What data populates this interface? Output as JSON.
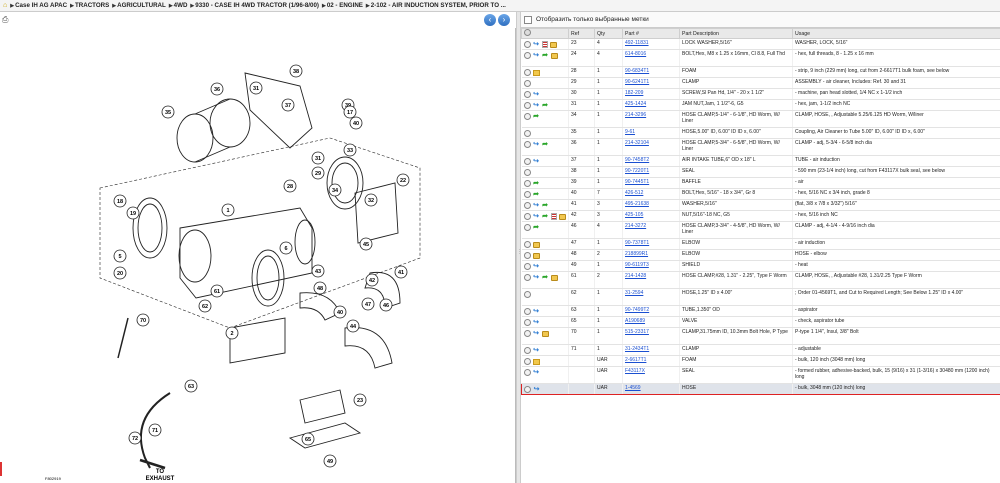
{
  "breadcrumb": [
    "Case IH AG APAC",
    "TRACTORS",
    "AGRICULTURAL",
    "4WD",
    "9330 - CASE IH 4WD TRACTOR (1/96-8/00)",
    "02 - ENGINE",
    "2-102 - AIR INDUCTION SYSTEM, PRIOR TO ..."
  ],
  "filter_label": "Отобразить только выбранные метки",
  "columns": {
    "ref": "Ref",
    "qty": "Qty",
    "part": "Part #",
    "desc": "Part Description",
    "usage": "Usage"
  },
  "diagram": {
    "callouts": [
      "38",
      "31",
      "36",
      "37",
      "39",
      "17",
      "40",
      "35",
      "33",
      "31",
      "29",
      "28",
      "32",
      "34",
      "22",
      "1",
      "6",
      "18",
      "19",
      "42",
      "43",
      "45",
      "48",
      "40",
      "44",
      "41",
      "46",
      "47",
      "5",
      "20",
      "61",
      "2",
      "70",
      "62",
      "63",
      "71",
      "72",
      "49",
      "65",
      "23"
    ],
    "exhaust_label": "TO\nEXHAUST",
    "figure_id": "F802919"
  },
  "rows": [
    {
      "icons": [
        "info",
        "arrow",
        "doc",
        "pkg"
      ],
      "ref": "23",
      "qty": "4",
      "part": "492-11831",
      "desc": "LOCK WASHER,5/16\"",
      "usage": "WASHER, LOCK, 5/16\"",
      "h": 1
    },
    {
      "icons": [
        "info",
        "arrow",
        "green",
        "pkg"
      ],
      "ref": "24",
      "qty": "4",
      "part": "614-8016",
      "desc": "BOLT,Hex, M8 x 1.25 x 16mm, Cl 8.8, Full Thd",
      "usage": "- hex, full threads, 8 - 1.25 x 16 mm",
      "h": 2
    },
    {
      "icons": [
        "info",
        "note"
      ],
      "ref": "28",
      "qty": "1",
      "part": "90-6834T1",
      "desc": "FOAM",
      "usage": "- strip, 9 inch (229 mm) long, cut from 2-6617T1 bulk foam, see below",
      "h": 1
    },
    {
      "icons": [
        "info"
      ],
      "ref": "29",
      "qty": "1",
      "part": "90-6241T1",
      "desc": "CLAMP",
      "usage": "ASSEMBLY - air cleaner, Includes: Ref. 30 and 31",
      "h": 1
    },
    {
      "icons": [
        "info",
        "arrow"
      ],
      "ref": "30",
      "qty": "1",
      "part": "182-209",
      "desc": "SCREW,Sl Pan Hd, 1/4\" - 20 x 1 1/2\"",
      "usage": "- machine, pan head slotted, 1/4 NC x 1-1/2 inch",
      "h": 1
    },
    {
      "icons": [
        "info",
        "arrow",
        "green"
      ],
      "ref": "31",
      "qty": "1",
      "part": "425-1424",
      "desc": "JAM NUT,Jam, 1 1/2\"-6, G5",
      "usage": "- hex, jam, 1-1/2 inch NC",
      "h": 1
    },
    {
      "icons": [
        "info",
        "green"
      ],
      "ref": "34",
      "qty": "1",
      "part": "214-3296",
      "desc": "HOSE CLAMP,5-1/4\" - 6-1/8\", HD Worm, W/ Liner",
      "usage": "CLAMP, HOSE, , Adjustable 5.25/6.125 HD Worm, W/liner",
      "h": 2
    },
    {
      "icons": [
        "info"
      ],
      "ref": "35",
      "qty": "1",
      "part": "9-61",
      "desc": "HOSE,5.00\" ID, 6.00\" ID ID x, 6.00\"",
      "usage": "Coupling, Air Cleaner to Tube 5.00\" ID, 6.00\" ID ID x, 6.00\"",
      "h": 1
    },
    {
      "icons": [
        "info",
        "arrow",
        "green"
      ],
      "ref": "36",
      "qty": "1",
      "part": "214-32104",
      "desc": "HOSE CLAMP,5-3/4\" - 6-5/8\", HD Worm, W/ Liner",
      "usage": "CLAMP - adj, 5-3/4 - 6-5/8 inch dia",
      "h": 2
    },
    {
      "icons": [
        "info",
        "arrow"
      ],
      "ref": "37",
      "qty": "1",
      "part": "90-7458T2",
      "desc": "AIR INTAKE TUBE,6\" OD x 18\" L",
      "usage": "TUBE - air induction",
      "h": 1
    },
    {
      "icons": [
        "info"
      ],
      "ref": "38",
      "qty": "1",
      "part": "90-7220T1",
      "desc": "SEAL",
      "usage": "- 590 mm (23-1/4 inch) long, cut from F43117X bulk seal, see below",
      "h": 1
    },
    {
      "icons": [
        "info",
        "green"
      ],
      "ref": "39",
      "qty": "1",
      "part": "90-7445T1",
      "desc": "BAFFLE",
      "usage": "- air",
      "h": 1
    },
    {
      "icons": [
        "info",
        "green"
      ],
      "ref": "40",
      "qty": "7",
      "part": "426-512",
      "desc": "BOLT,Hex, 5/16\" - 18 x 3/4\", Gr 8",
      "usage": "- hex, 5/16 NC x 3/4 inch, grade 8",
      "h": 1
    },
    {
      "icons": [
        "info",
        "arrow",
        "green"
      ],
      "ref": "41",
      "qty": "3",
      "part": "495-21638",
      "desc": "WASHER,5/16\"",
      "usage": "(flat, 3/8 x 7/8 x 3/32\") 5/16\"",
      "h": 1
    },
    {
      "icons": [
        "info",
        "arrow",
        "green",
        "doc",
        "pkg"
      ],
      "ref": "42",
      "qty": "3",
      "part": "425-105",
      "desc": "NUT,5/16\"-18 NC, G5",
      "usage": "- hex, 5/16 inch NC",
      "h": 1
    },
    {
      "icons": [
        "info",
        "green"
      ],
      "ref": "46",
      "qty": "4",
      "part": "214-3272",
      "desc": "HOSE CLAMP,3-3/4\" - 4-5/8\", HD Worm, W/ Liner",
      "usage": "CLAMP - adj, 4-1/4 - 4-9/16 inch dia",
      "h": 2
    },
    {
      "icons": [
        "info",
        "pkg"
      ],
      "ref": "47",
      "qty": "1",
      "part": "90-7378T1",
      "desc": "ELBOW",
      "usage": "- air induction",
      "h": 1
    },
    {
      "icons": [
        "info",
        "pkg"
      ],
      "ref": "48",
      "qty": "2",
      "part": "218899R1",
      "desc": "ELBOW",
      "usage": "HOSE - elbow",
      "h": 1
    },
    {
      "icons": [
        "info",
        "arrow"
      ],
      "ref": "49",
      "qty": "1",
      "part": "90-6119T3",
      "desc": "SHIELD",
      "usage": "- heat",
      "h": 1
    },
    {
      "icons": [
        "info",
        "arrow",
        "green",
        "pkg"
      ],
      "ref": "61",
      "qty": "2",
      "part": "214-1428",
      "desc": "HOSE CLAMP,#28, 1.31\" - 2.25\", Type F Worm",
      "usage": "CLAMP, HOSE, , Adjustable #28, 1.31/2.25 Type F Worm",
      "h": 2
    },
    {
      "icons": [
        "info"
      ],
      "ref": "62",
      "qty": "1",
      "part": "31-2594",
      "desc": "HOSE,1.25\" ID x 4.00\"",
      "usage": "; Order 01-4569T1, and Cut to Required Length; See Below 1.25\" ID x 4.00\"",
      "h": 2
    },
    {
      "icons": [
        "info",
        "arrow"
      ],
      "ref": "63",
      "qty": "1",
      "part": "90-7499T2",
      "desc": "TUBE,1.350\" OD",
      "usage": "- aspirator",
      "h": 1
    },
    {
      "icons": [
        "info",
        "arrow"
      ],
      "ref": "65",
      "qty": "1",
      "part": "A190689",
      "desc": "VALVE",
      "usage": "- check, aspirator tube",
      "h": 1
    },
    {
      "icons": [
        "info",
        "arrow",
        "pkg"
      ],
      "ref": "70",
      "qty": "1",
      "part": "515-23317",
      "desc": "CLAMP,31.75mm ID, 10.3mm Bolt Hole, P Type",
      "usage": "P-type 1 1/4\", Insul, 3/8\" Bolt",
      "h": 2
    },
    {
      "icons": [
        "info",
        "arrow"
      ],
      "ref": "71",
      "qty": "1",
      "part": "31-2434T1",
      "desc": "CLAMP",
      "usage": "- adjustable",
      "h": 1
    },
    {
      "icons": [
        "info",
        "note"
      ],
      "ref": "",
      "qty": "UAR",
      "part": "2-6617T1",
      "desc": "FOAM",
      "usage": "- bulk, 120 inch (3048 mm) long",
      "h": 1
    },
    {
      "icons": [
        "info",
        "arrow"
      ],
      "ref": "",
      "qty": "UAR",
      "part": "F43117X",
      "desc": "SEAL",
      "usage": "- formed rubber, adhesive-backed, bulk, 15 (9/16) x 31 (1-3/16) x 30480 mm (1200 inch) long",
      "h": 2
    },
    {
      "icons": [
        "info",
        "arrow"
      ],
      "ref": "",
      "qty": "UAR",
      "part": "1-4569",
      "desc": "HOSE",
      "usage": "- bulk, 3048 mm (120 inch) long",
      "h": 1,
      "selected": true
    }
  ]
}
